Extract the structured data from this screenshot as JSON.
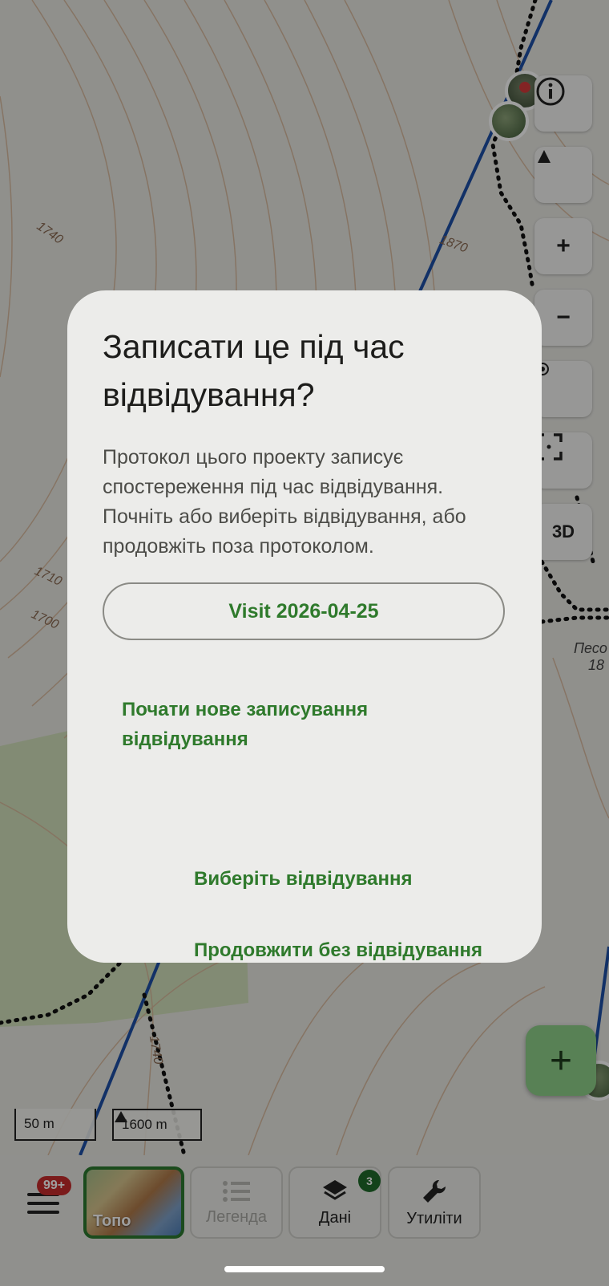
{
  "map": {
    "contour_labels": [
      "1740",
      "1870",
      "1710",
      "1700",
      "1740"
    ],
    "peak_label": [
      "Песо",
      "18"
    ],
    "scale": {
      "distance": "50 m",
      "elevation": "1600 m"
    },
    "controls": [
      "info-icon",
      "compass-icon",
      "zoom-in-icon",
      "zoom-out-icon",
      "location-icon",
      "fullscreen-icon",
      "3D"
    ],
    "controls_3d_label": "3D",
    "fab_icon": "plus-icon"
  },
  "dialog": {
    "title": "Записати це під час відвідування?",
    "body": "Протокол цього проекту записує спостереження під час відвідування. Почніть або виберіть відвідування, або продовжіть поза протоколом.",
    "visit_button": "Visit 2026-04-25",
    "new_visit": "Почати нове записування відвідування",
    "choose_visit": "Виберіть відвідування",
    "continue_without": "Продовжити без відвідування"
  },
  "bottom_bar": {
    "menu_badge": "99+",
    "topo_label": "Топо",
    "legend_label": "Легенда",
    "data_label": "Дані",
    "data_badge": "3",
    "tools_label": "Утиліти"
  },
  "colors": {
    "accent": "#2f7a2c",
    "fab": "#8fd18a",
    "badge_red": "#c72c2c",
    "route_blue": "#1e4fa6"
  }
}
